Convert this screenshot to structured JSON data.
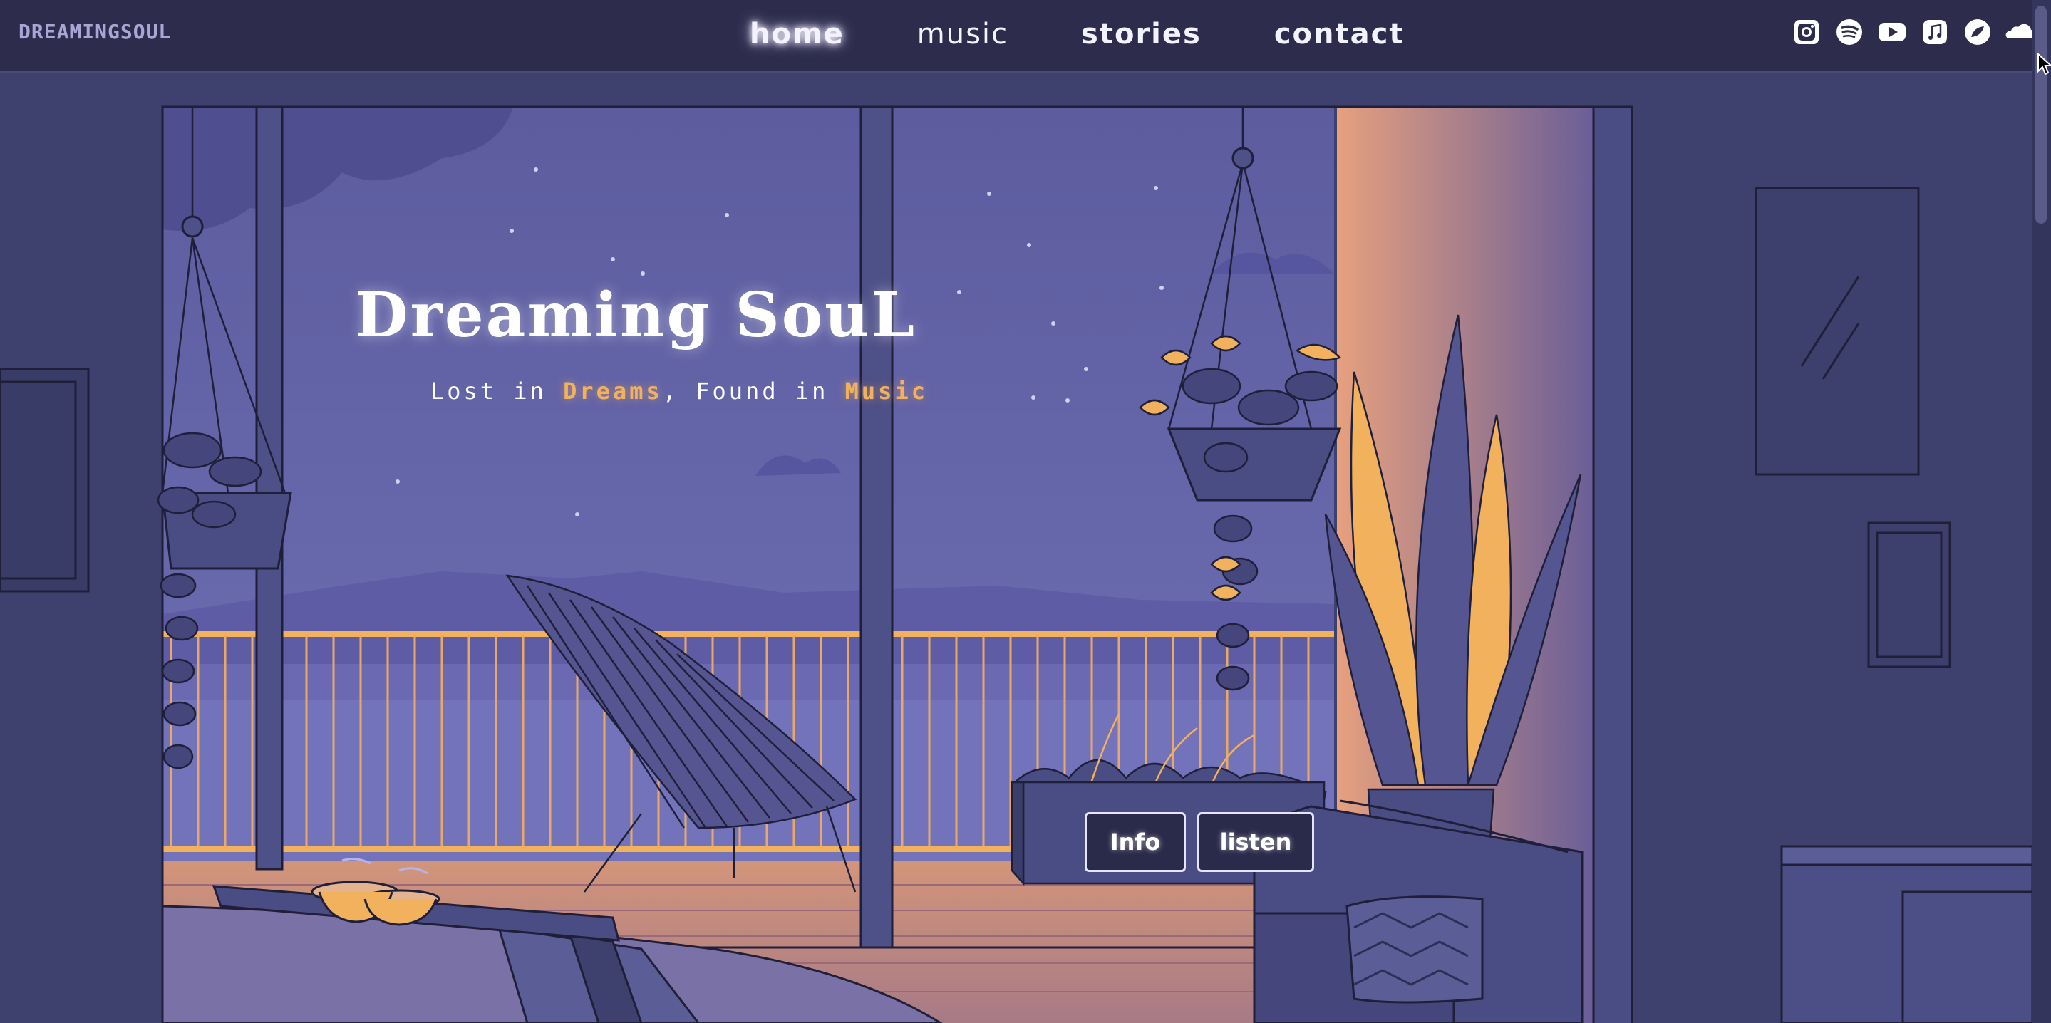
{
  "brand": {
    "logo": "DREAMINGSOUL"
  },
  "nav": {
    "items": [
      {
        "label": "home"
      },
      {
        "label": "music"
      },
      {
        "label": "stories"
      },
      {
        "label": "contact"
      }
    ]
  },
  "socials": [
    {
      "icon": "instagram-icon"
    },
    {
      "icon": "spotify-icon"
    },
    {
      "icon": "youtube-icon"
    },
    {
      "icon": "apple-music-icon"
    },
    {
      "icon": "deezer-icon"
    },
    {
      "icon": "soundcloud-icon"
    }
  ],
  "hero": {
    "title": "Dreaming SouL",
    "subtitle": {
      "part1": "Lost in ",
      "highlight1": "Dreams",
      "part2": ", Found in ",
      "highlight2": "Music"
    }
  },
  "buttons": {
    "info": "Info",
    "listen": "listen"
  },
  "colors": {
    "accent": "#f2b15c",
    "navbar": "#2d2c4c",
    "wall": "#3d3f6c",
    "sky": "#6464a8"
  }
}
